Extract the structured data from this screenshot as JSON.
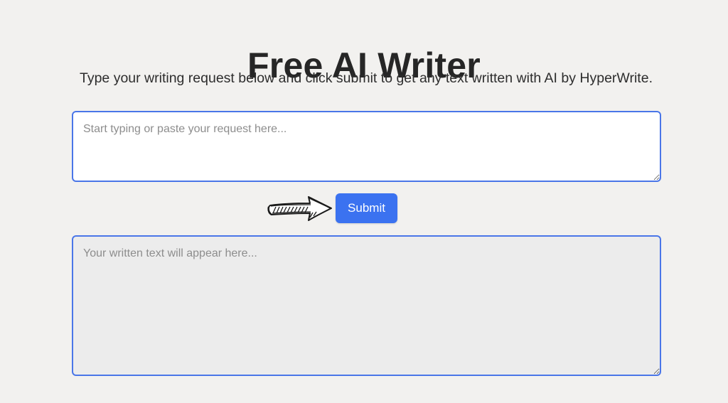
{
  "header": {
    "title": "Free AI Writer",
    "subtitle": "Type your writing request below and click submit to get any text written with AI by HyperWrite."
  },
  "request": {
    "placeholder": "Start typing or paste your request here...",
    "value": ""
  },
  "submit": {
    "label": "Submit"
  },
  "output": {
    "placeholder": "Your written text will appear here...",
    "value": ""
  },
  "decoration": {
    "icon": "hand-drawn-arrow-right-icon"
  },
  "colors": {
    "background": "#f2f1ef",
    "accent": "#3b72f0",
    "border": "#4a76e8",
    "output_background": "#ececec",
    "text": "#262626"
  }
}
